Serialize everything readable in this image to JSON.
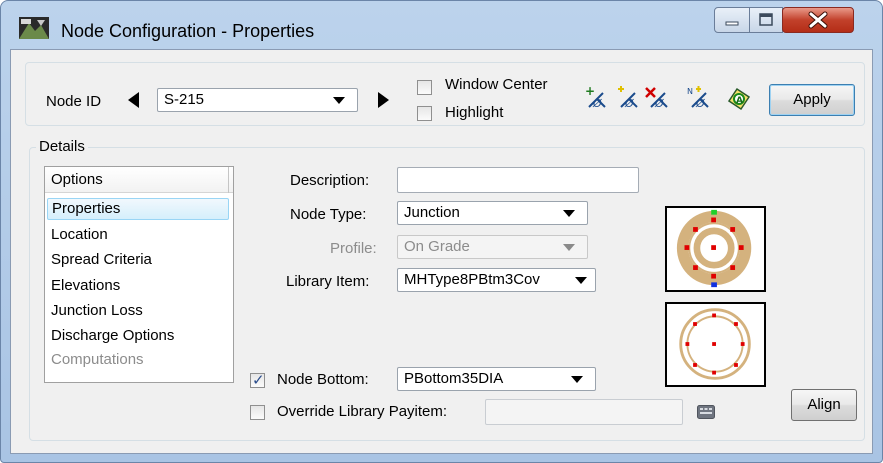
{
  "window": {
    "title": "Node Configuration - Properties",
    "icons": {
      "app": "manhole-app-icon",
      "minimize": "minimize-icon",
      "maximize": "maximize-icon",
      "close": "close-icon"
    }
  },
  "toolbar": {
    "node_id_label": "Node ID",
    "node_id_value": "S-215",
    "window_center_label": "Window Center",
    "window_center_checked": false,
    "highlight_label": "Highlight",
    "highlight_checked": false,
    "tool_icons": [
      "add-node-icon",
      "select-node-icon",
      "delete-node-icon",
      "renumber-node-icon",
      "node-report-icon"
    ],
    "apply_label": "Apply"
  },
  "details": {
    "group_label": "Details",
    "options_header": "Options",
    "options": [
      "Properties",
      "Location",
      "Spread Criteria",
      "Elevations",
      "Junction Loss",
      "Discharge Options",
      "Computations"
    ],
    "selected_option": "Properties",
    "disabled_option": "Computations"
  },
  "form": {
    "description_label": "Description:",
    "description_value": "",
    "node_type_label": "Node Type:",
    "node_type_value": "Junction",
    "profile_label": "Profile:",
    "profile_value": "On Grade",
    "library_item_label": "Library Item:",
    "library_item_value": "MHType8PBtm3Cov",
    "node_bottom_label": "Node Bottom:",
    "node_bottom_checked": true,
    "node_bottom_value": "PBottom35DIA",
    "override_payitem_label": "Override Library Payitem:",
    "override_payitem_checked": false,
    "override_payitem_value": "",
    "browse_icon": "keyboard-browse-icon",
    "align_label": "Align"
  },
  "colors": {
    "accent_red": "#e00000",
    "ring_tan": "#d4b27e",
    "top_marker": "#1fd02a",
    "bottom_marker": "#1030e0"
  }
}
